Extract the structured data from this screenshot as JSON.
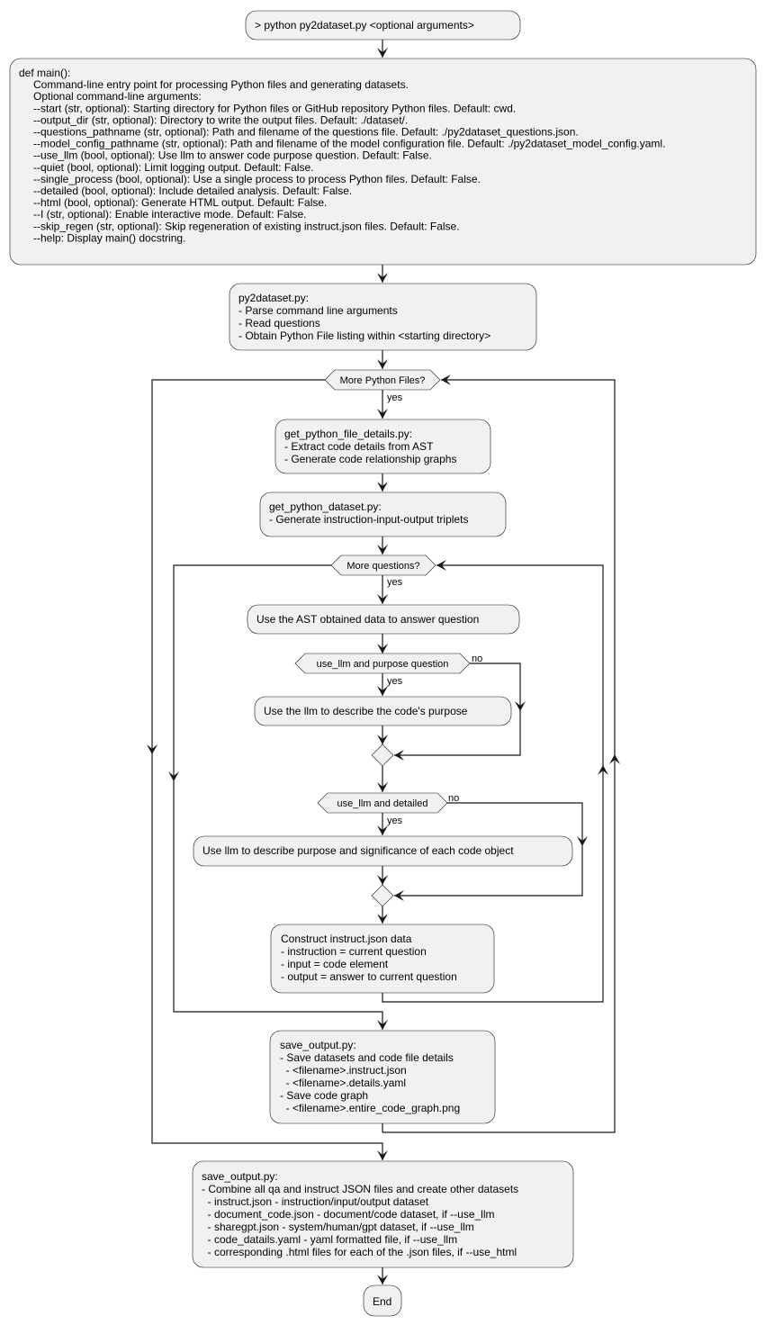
{
  "nodes": {
    "start": {
      "lines": [
        "> python py2dataset.py <optional arguments>"
      ]
    },
    "main": {
      "lines": [
        "def main():",
        "Command-line entry point for processing Python files and generating datasets.",
        "Optional command-line arguments:",
        "--start (str, optional): Starting directory for Python files or GitHub repository Python files. Default: cwd.",
        "--output_dir (str, optional): Directory to write the output files. Default: ./dataset/.",
        "--questions_pathname (str, optional): Path and filename of the questions file. Default: ./py2dataset_questions.json.",
        "--model_config_pathname (str, optional): Path and filename of the model configuration file. Default: ./py2dataset_model_config.yaml.",
        "--use_llm (bool, optional): Use llm to answer code purpose question. Default: False.",
        "--quiet (bool, optional): Limit logging output. Default: False.",
        "--single_process (bool, optional): Use a single process to process Python files. Default: False.",
        "--detailed (bool, optional): Include detailed analysis. Default: False.",
        "--html (bool, optional): Generate HTML output. Default: False.",
        "--I (str, optional): Enable interactive mode. Default: False.",
        "--skip_regen (str, optional): Skip regeneration of existing instruct.json files. Default: False.",
        "--help: Display main() docstring."
      ]
    },
    "parse": {
      "lines": [
        "py2dataset.py:",
        "- Parse command line arguments",
        "- Read questions",
        "- Obtain Python File listing within <starting directory>"
      ]
    },
    "details": {
      "lines": [
        "get_python_file_details.py:",
        "- Extract code details from AST",
        "- Generate code relationship graphs"
      ]
    },
    "dataset": {
      "lines": [
        "get_python_dataset.py:",
        "- Generate instruction-input-output triplets"
      ]
    },
    "ast_answer": {
      "lines": [
        "Use the AST obtained data to answer question"
      ]
    },
    "llm_purpose": {
      "lines": [
        "Use the llm to describe the code's purpose"
      ]
    },
    "llm_detailed": {
      "lines": [
        "Use llm to describe purpose and significance of each code object"
      ]
    },
    "construct": {
      "lines": [
        "Construct instruct.json data",
        "- instruction = current question",
        "- input = code element",
        "- output = answer to current question"
      ]
    },
    "save1": {
      "lines": [
        "save_output.py:",
        "- Save datasets and code file details",
        "  - <filename>.instruct.json",
        "  - <filename>.details.yaml",
        "- Save code graph",
        "  - <filename>.entire_code_graph.png"
      ]
    },
    "save2": {
      "lines": [
        "save_output.py:",
        "- Combine all qa and instruct JSON files and create other datasets",
        "  - instruct.json - instruction/input/output dataset",
        "  - document_code.json - document/code dataset, if --use_llm",
        "  - sharegpt.json - system/human/gpt dataset, if --use_llm",
        "  - code_datails.yaml - yaml formatted file, if --use_llm",
        "  - corresponding .html files for each of the .json files, if --use_html"
      ]
    },
    "end": {
      "lines": [
        "End"
      ]
    }
  },
  "decisions": {
    "more_files": {
      "label": "More Python Files?",
      "yes": "yes"
    },
    "more_questions": {
      "label": "More questions?",
      "yes": "yes"
    },
    "purpose": {
      "label": "use_llm and purpose question",
      "yes": "yes",
      "no": "no"
    },
    "detailed": {
      "label": "use_llm and detailed",
      "yes": "yes",
      "no": "no"
    }
  },
  "colors": {
    "node_fill": "#f1f1f1",
    "stroke": "#181818"
  }
}
